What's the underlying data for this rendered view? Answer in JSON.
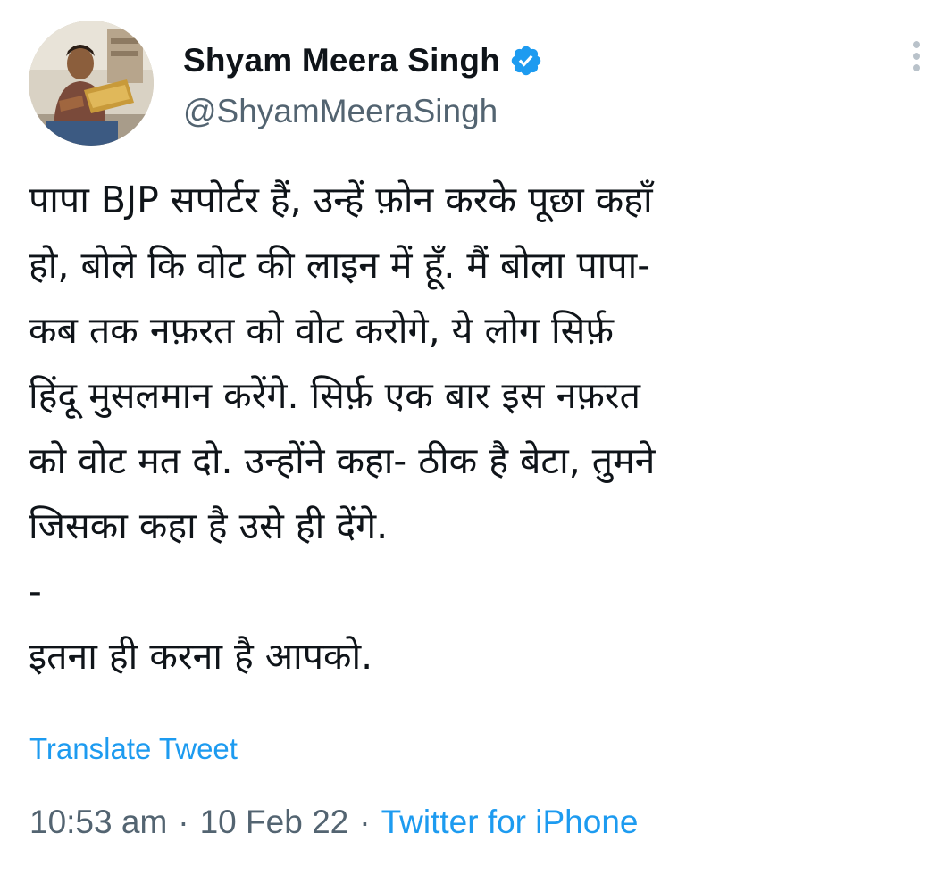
{
  "tweet": {
    "author": {
      "display_name": "Shyam Meera Singh",
      "handle": "@ShyamMeeraSingh",
      "verified": true
    },
    "text": "पापा BJP सपोर्टर हैं, उन्हें फ़ोन करके पूछा कहाँ\nहो, बोले कि वोट की लाइन में हूँ. मैं बोला पापा-\nकब तक नफ़रत को वोट करोगे, ये लोग सिर्फ़\nहिंदू मुसलमान करेंगे. सिर्फ़ एक बार इस नफ़रत\nको वोट मत दो. उन्होंने कहा- ठीक है बेटा, तुमने\nजिसका कहा है उसे ही देंगे.\n-\nइतना ही करना है आपको.",
    "translate_label": "Translate Tweet",
    "time": "10:53 am",
    "separator": "·",
    "date": "10 Feb 22",
    "source": "Twitter for iPhone"
  },
  "icons": {
    "verified": "verified-badge-icon",
    "more": "more-options-icon"
  },
  "colors": {
    "accent": "#1d9bf0",
    "secondary_text": "#536471",
    "primary_text": "#0f1419"
  }
}
